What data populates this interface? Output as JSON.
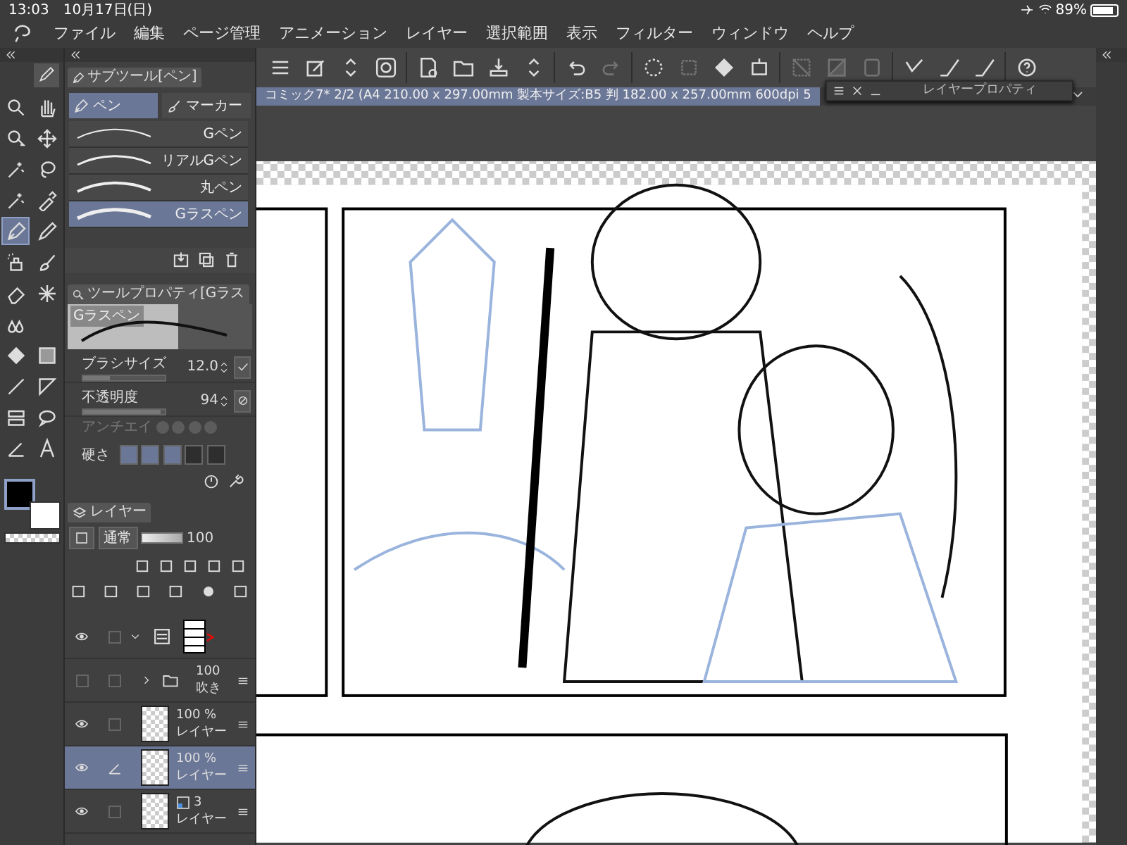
{
  "status_bar": {
    "time": "13:03",
    "date": "10月17日(日)",
    "battery": "89%"
  },
  "menu": [
    "ファイル",
    "編集",
    "ページ管理",
    "アニメーション",
    "レイヤー",
    "選択範囲",
    "表示",
    "フィルター",
    "ウィンドウ",
    "ヘルプ"
  ],
  "toolbar": [
    [
      {
        "kind": "menu",
        "disabled": false
      },
      {
        "kind": "edit",
        "disabled": false
      },
      {
        "kind": "updown",
        "disabled": false
      },
      {
        "kind": "swirl",
        "disabled": false
      }
    ],
    [
      {
        "kind": "new",
        "disabled": false
      },
      {
        "kind": "open",
        "disabled": false
      },
      {
        "kind": "save",
        "disabled": false
      },
      {
        "kind": "updown",
        "disabled": false
      }
    ],
    [
      {
        "kind": "undo",
        "disabled": false
      },
      {
        "kind": "redo",
        "disabled": true
      }
    ],
    [
      {
        "kind": "spinner",
        "disabled": false
      },
      {
        "kind": "crop",
        "disabled": true
      },
      {
        "kind": "fill",
        "disabled": false
      },
      {
        "kind": "transform",
        "disabled": false
      }
    ],
    [
      {
        "kind": "slash",
        "disabled": true
      },
      {
        "kind": "halftone",
        "disabled": true
      },
      {
        "kind": "square",
        "disabled": true
      }
    ],
    [
      {
        "kind": "check",
        "disabled": false
      },
      {
        "kind": "ramp",
        "disabled": false
      },
      {
        "kind": "ramp",
        "disabled": false
      }
    ],
    [
      {
        "kind": "help",
        "disabled": false
      }
    ]
  ],
  "tools": [
    {
      "kind": "zoom",
      "selected": false
    },
    {
      "kind": "hand",
      "selected": false
    },
    {
      "kind": "operation",
      "selected": false
    },
    {
      "kind": "move",
      "selected": false
    },
    {
      "kind": "wand",
      "selected": false
    },
    {
      "kind": "lasso",
      "selected": false
    },
    {
      "kind": "wand",
      "selected": false
    },
    {
      "kind": "dropper",
      "selected": false
    },
    {
      "kind": "pen",
      "selected": true
    },
    {
      "kind": "pencil",
      "selected": false
    },
    {
      "kind": "airbrush",
      "selected": false
    },
    {
      "kind": "brush",
      "selected": false
    },
    {
      "kind": "eraser",
      "selected": false
    },
    {
      "kind": "sparkle",
      "selected": false
    },
    {
      "kind": "blend",
      "selected": false
    },
    {
      "kind": "none"
    },
    {
      "kind": "fill",
      "selected": false
    },
    {
      "kind": "gradient",
      "selected": false
    },
    {
      "kind": "line",
      "selected": false
    },
    {
      "kind": "ruler",
      "selected": false
    },
    {
      "kind": "frame",
      "selected": false
    },
    {
      "kind": "balloon",
      "selected": false
    },
    {
      "kind": "correct",
      "selected": false
    },
    {
      "kind": "text",
      "selected": false
    }
  ],
  "color_swatches": [
    {
      "kind": "main",
      "selected": true
    },
    {
      "kind": "sub",
      "selected": false
    },
    {
      "kind": "transparent",
      "selected": false
    }
  ],
  "sub_tool": {
    "title": "サブツール[ペン]",
    "groups": [
      {
        "label": "ペン",
        "selected": true
      },
      {
        "label": "マーカー",
        "selected": false
      }
    ],
    "brushes": [
      {
        "label": "Gペン",
        "selected": false
      },
      {
        "label": "リアルGペン",
        "selected": false
      },
      {
        "label": "丸ペン",
        "selected": false
      },
      {
        "label": "Gラスペン",
        "selected": true
      }
    ]
  },
  "tool_property": {
    "title": "ツールプロパティ[Gラス",
    "preview_label": "Gラスペン",
    "params": [
      {
        "label": "ブラシサイズ",
        "value": "12.0",
        "level": 0.32,
        "on": true
      },
      {
        "label": "不透明度",
        "value": "94",
        "level": 0.94,
        "on": false
      }
    ],
    "antialias_label": "アンチエイ",
    "hardness": {
      "label": "硬さ",
      "level": 0.6
    }
  },
  "layer_panel": {
    "title": "レイヤー",
    "blend": "通常",
    "opacity": "100",
    "opacity_slider": {
      "level": 1.0
    },
    "layers": [
      {
        "kind": "frame",
        "visible": true,
        "editing": false,
        "expanded": true,
        "children": [
          {
            "kind": "folder",
            "visible": false,
            "editing": false,
            "expanded": false,
            "opacity": "100",
            "name": "吹き",
            "selected": false
          },
          {
            "kind": "raster",
            "visible": true,
            "opacity": "100 %",
            "name": "レイヤー",
            "selected": false,
            "editing": false
          },
          {
            "kind": "raster",
            "visible": true,
            "opacity": "100 %",
            "name": "レイヤー",
            "selected": true,
            "editing": true
          },
          {
            "kind": "vector",
            "visible": true,
            "opacity": "3",
            "name": "レイヤー",
            "selected": false,
            "editing": false
          }
        ]
      }
    ]
  },
  "document_tab": "コミック7* 2/2 (A4 210.00 x 297.00mm 製本サイズ:B5 判 182.00 x 257.00mm 600dpi 5",
  "floating_window": {
    "title": "レイヤープロパティ"
  }
}
